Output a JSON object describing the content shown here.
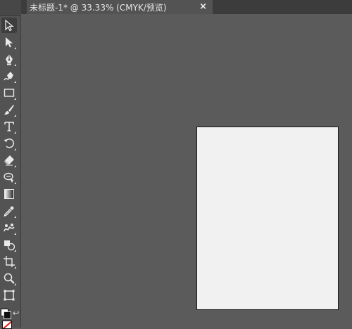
{
  "tab": {
    "title": "未标题-1* @ 33.33% (CMYK/预览)",
    "close_label": "×"
  },
  "toolbar": {
    "tools": [
      {
        "name": "selection-tool",
        "icon": "selection-arrow-icon",
        "active": true
      },
      {
        "name": "direct-selection-tool",
        "icon": "direct-selection-arrow-icon"
      },
      {
        "name": "pen-tool",
        "icon": "pen-icon"
      },
      {
        "name": "curvature-tool",
        "icon": "curvature-pen-icon"
      },
      {
        "name": "rectangle-tool",
        "icon": "rectangle-icon"
      },
      {
        "name": "paintbrush-tool",
        "icon": "paintbrush-icon"
      },
      {
        "name": "type-tool",
        "icon": "type-icon"
      },
      {
        "name": "rotate-tool",
        "icon": "rotate-icon"
      },
      {
        "name": "eraser-tool",
        "icon": "eraser-icon"
      },
      {
        "name": "warp-tool",
        "icon": "warp-icon"
      },
      {
        "name": "gradient-tool",
        "icon": "gradient-icon"
      },
      {
        "name": "eyedropper-tool",
        "icon": "eyedropper-icon"
      },
      {
        "name": "blend-tool",
        "icon": "blend-icon"
      },
      {
        "name": "shape-builder-tool",
        "icon": "shape-builder-icon"
      },
      {
        "name": "artboard-tool",
        "icon": "artboard-icon"
      },
      {
        "name": "zoom-tool",
        "icon": "zoom-icon"
      },
      {
        "name": "change-screen-mode-tool",
        "icon": "screen-mode-icon"
      }
    ],
    "swap_label": "↩"
  },
  "colors": {
    "canvas": "#5b5b5b",
    "panel": "#535353",
    "artboard": "#f1f1f1",
    "none_slash": "#e01818"
  }
}
